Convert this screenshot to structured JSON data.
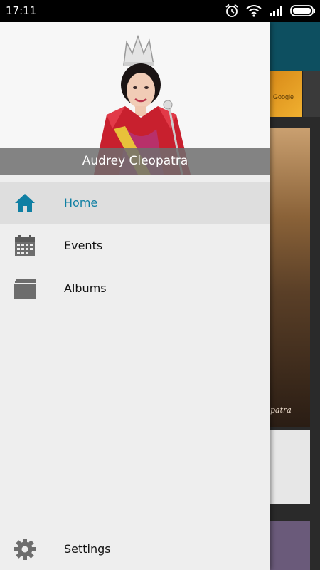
{
  "status_bar": {
    "time": "17:11",
    "icons": [
      "alarm-icon",
      "wifi-icon",
      "signal-icon",
      "battery-icon"
    ]
  },
  "drawer": {
    "header_name": "Audrey Cleopatra",
    "accent_color": "#0f7fa3",
    "items": [
      {
        "label": "Home",
        "icon": "home-icon",
        "active": true
      },
      {
        "label": "Events",
        "icon": "calendar-icon",
        "active": false
      },
      {
        "label": "Albums",
        "icon": "album-icon",
        "active": false
      }
    ],
    "settings_label": "Settings"
  },
  "background_app": {
    "banner_text": "Google",
    "photo_watermark": "patra"
  }
}
